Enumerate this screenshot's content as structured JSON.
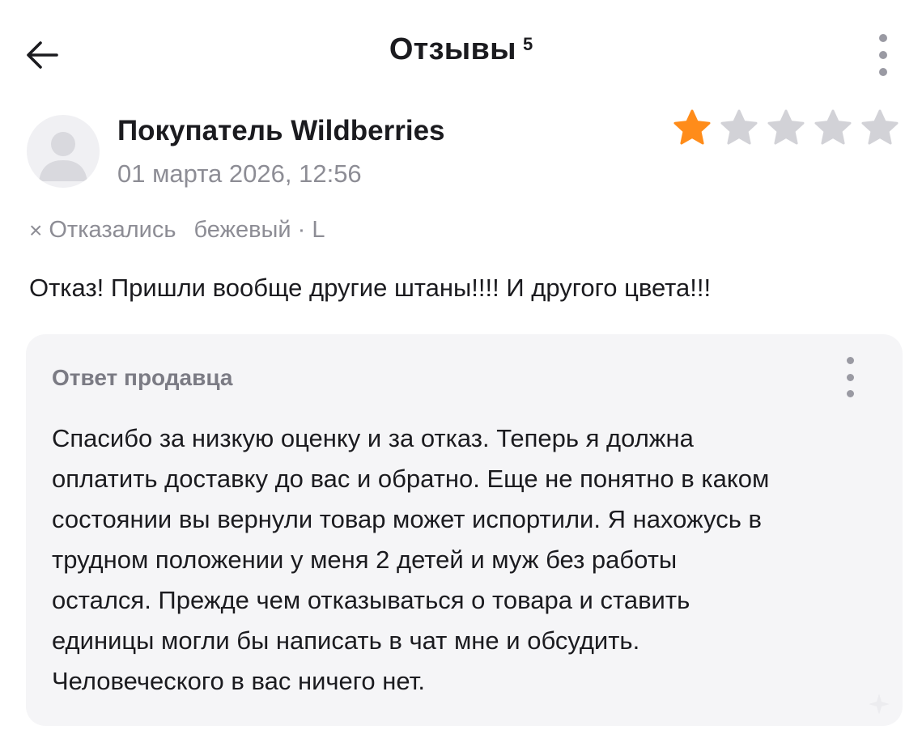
{
  "header": {
    "title": "Отзывы",
    "count": "5"
  },
  "review": {
    "author": "Покупатель Wildberries",
    "date": "01 марта 2026, 12:56",
    "rating": 1,
    "rating_max": 5,
    "status": "Отказались",
    "variant": "бежевый · L",
    "text": "Отказ! Пришли вообще другие штаны!!!! И другого цвета!!!"
  },
  "seller_reply": {
    "title": "Ответ продавца",
    "lines": [
      "Спасибо за низкую оценку и за отказ. Теперь я должна",
      "оплатить доставку до вас и обратно. Еще не понятно в каком",
      "состоянии вы вернули товар может испортили. Я нахожусь в",
      "трудном положении у меня 2 детей и муж без работы",
      "остался. Прежде чем отказываться о товара и ставить",
      "единицы могли бы написать в чат мне и обсудить.",
      "Человеческого в вас ничего нет."
    ]
  },
  "colors": {
    "star_active": "#FF8C1A",
    "star_inactive": "#D2D2D7",
    "muted_text": "#8D8D95",
    "reply_bg": "#F5F5F7"
  },
  "icons": {
    "back": "arrow-left-icon",
    "menu": "more-vertical-icon",
    "avatar": "user-placeholder-icon",
    "star": "star-icon",
    "status": "close-icon"
  }
}
